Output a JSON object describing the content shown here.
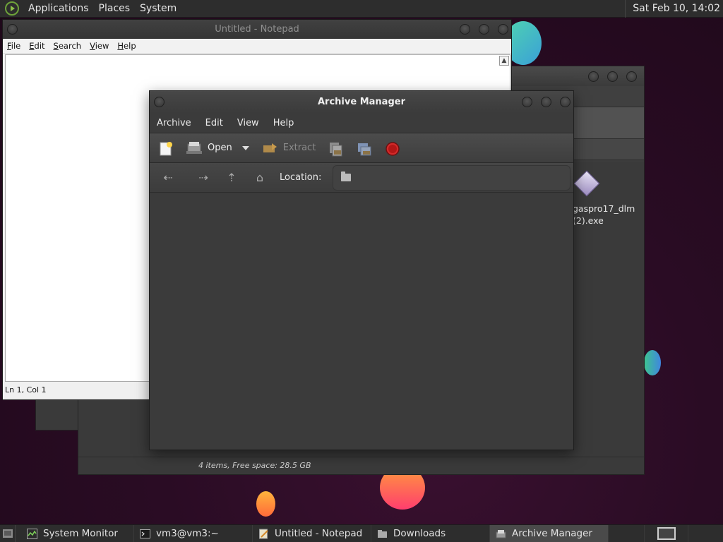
{
  "top_panel": {
    "menus": [
      "Applications",
      "Places",
      "System"
    ],
    "clock": "Sat Feb 10, 14:02"
  },
  "notepad": {
    "title": "Untitled - Notepad",
    "menu": [
      "File",
      "Edit",
      "Search",
      "View",
      "Help"
    ],
    "status": "Ln 1, Col 1"
  },
  "file_manager": {
    "file_label_line1": "gaspro17_dlm",
    "file_label_line2": "(2).exe",
    "status": "4 items, Free space: 28.5 GB"
  },
  "archive_manager": {
    "title": "Archive Manager",
    "menu": [
      "Archive",
      "Edit",
      "View",
      "Help"
    ],
    "toolbar": {
      "open_label": "Open",
      "extract_label": "Extract"
    },
    "location_label": "Location:"
  },
  "taskbar": {
    "tasks": [
      "System Monitor",
      "vm3@vm3:~",
      "Untitled - Notepad",
      "Downloads",
      "Archive Manager"
    ],
    "active_task": "Archive Manager"
  },
  "colors": {
    "panel_bg": "#2d2d2d",
    "window_dark": "#3a3a3a",
    "desktop_bg": "#2a0d24"
  }
}
